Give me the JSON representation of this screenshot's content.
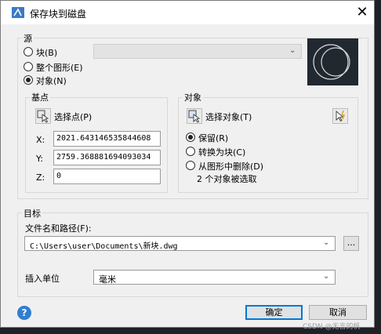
{
  "window": {
    "title": "保存块到磁盘",
    "close_glyph": "✕"
  },
  "source": {
    "legend": "源",
    "options": [
      {
        "label": "块(B)",
        "selected": false
      },
      {
        "label": "整个图形(E)",
        "selected": false
      },
      {
        "label": "对象(N)",
        "selected": true
      }
    ],
    "block_select_value": ""
  },
  "basepoint": {
    "legend": "基点",
    "pick_label": "选择点(P)",
    "x_label": "X:",
    "y_label": "Y:",
    "z_label": "Z:",
    "x_value": "2021.643146535844608",
    "y_value": "2759.368881694093034",
    "z_value": "0"
  },
  "objects": {
    "legend": "对象",
    "select_label": "选择对象(T)",
    "options": [
      {
        "label": "保留(R)",
        "selected": true
      },
      {
        "label": "转换为块(C)",
        "selected": false
      },
      {
        "label": "从图形中删除(D)",
        "selected": false
      }
    ],
    "status": "2 个对象被选取"
  },
  "destination": {
    "legend": "目标",
    "file_label": "文件名和路径(F):",
    "file_value": "C:\\Users\\user\\Documents\\新块.dwg",
    "browse_label": "...",
    "units_label": "插入单位",
    "units_value": "毫米"
  },
  "buttons": {
    "ok": "确定",
    "cancel": "取消",
    "help": "?"
  },
  "watermark": "CSDN @无言的帆"
}
